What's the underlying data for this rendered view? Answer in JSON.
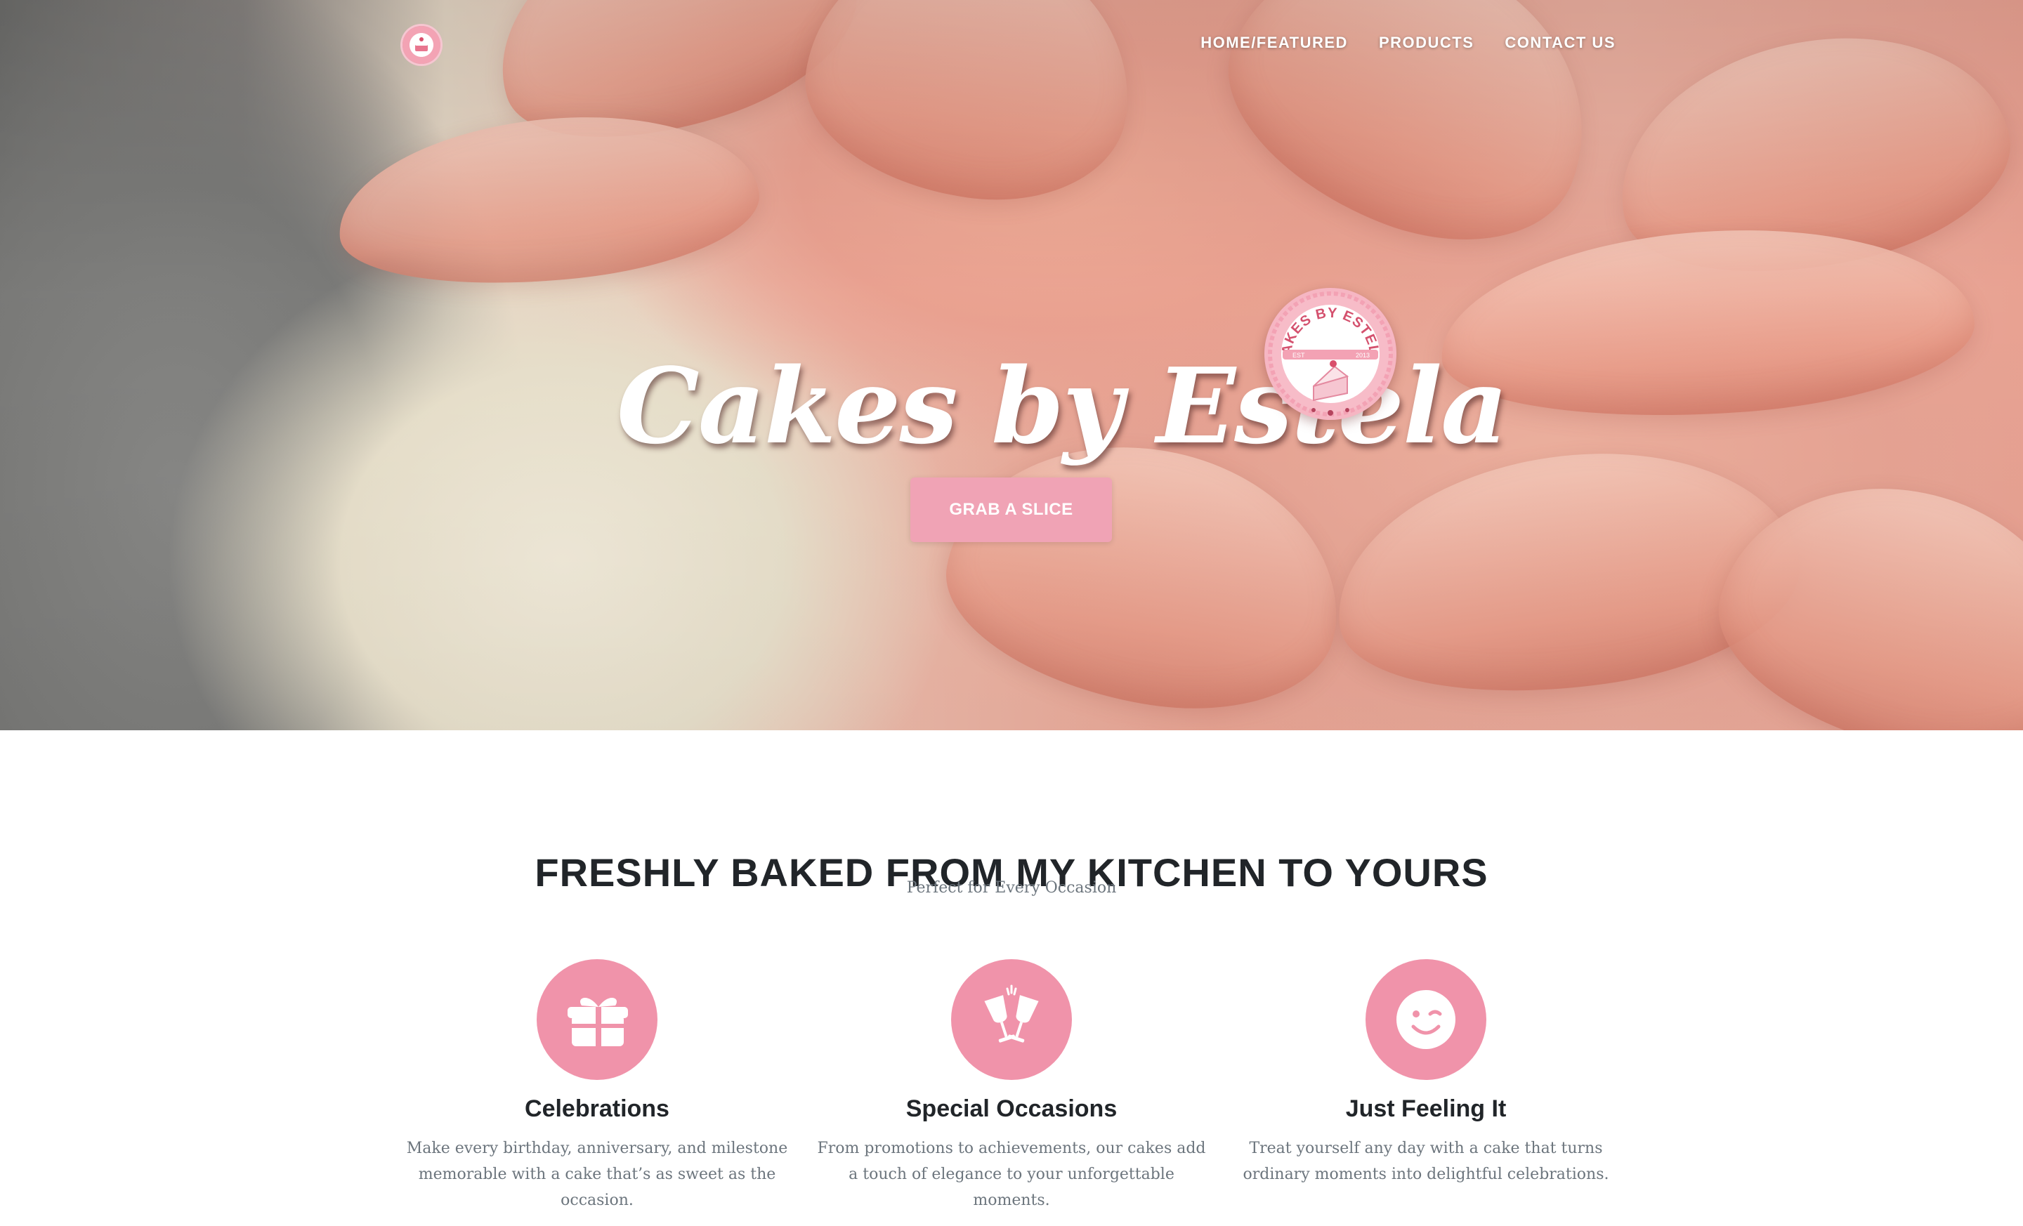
{
  "nav": {
    "items": [
      "HOME/FEATURED",
      "PRODUCTS",
      "CONTACT US"
    ]
  },
  "hero": {
    "title": "Cakes by Estela",
    "badge_text": "CAKES BY ESTELA",
    "badge_est": "EST",
    "badge_year": "2013",
    "cta_label": "GRAB A SLICE"
  },
  "intro": {
    "heading": "FRESHLY BAKED FROM MY KITCHEN TO YOURS",
    "subheading": "Perfect for Every Occasion"
  },
  "features": [
    {
      "icon": "gift-icon",
      "title": "Celebrations",
      "text": "Make every birthday, anniversary, and milestone memorable with a cake that’s as sweet as the occasion."
    },
    {
      "icon": "glasses-cheers-icon",
      "title": "Special Occasions",
      "text": "From promotions to achievements, our cakes add a touch of elegance to your unforgettable moments."
    },
    {
      "icon": "wink-icon",
      "title": "Just Feeling It",
      "text": "Treat yourself any day with a cake that turns ordinary moments into delightful celebrations."
    }
  ],
  "colors": {
    "accent_pink": "#f093aa",
    "button_pink": "#f0a3b5",
    "heading_dark": "#212529",
    "muted_text": "#6c757d"
  }
}
